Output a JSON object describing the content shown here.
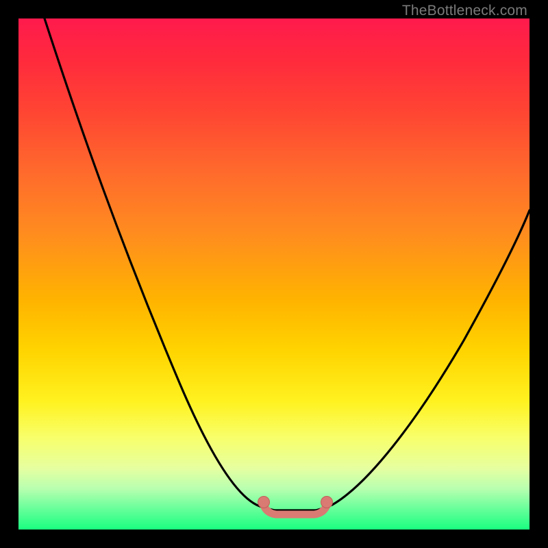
{
  "watermark": "TheBottleneck.com",
  "colors": {
    "frame": "#000000",
    "curve": "#000000",
    "marker_fill": "#d97a73",
    "marker_stroke": "#c06058",
    "gradient_stops": [
      "#ff1a4d",
      "#ff2a3d",
      "#ff4433",
      "#ff6a2c",
      "#ff8c1f",
      "#ffb300",
      "#ffd400",
      "#fff220",
      "#f8ff6a",
      "#e6ffa0",
      "#b8ffb0",
      "#66ff99",
      "#1aff80"
    ]
  },
  "chart_data": {
    "type": "line",
    "title": "",
    "xlabel": "",
    "ylabel": "",
    "xlim": [
      0,
      100
    ],
    "ylim": [
      0,
      100
    ],
    "series": [
      {
        "name": "bottleneck-curve",
        "x": [
          0,
          5,
          10,
          15,
          20,
          25,
          30,
          35,
          40,
          45,
          48,
          50,
          52,
          54,
          56,
          58,
          62,
          68,
          75,
          82,
          90,
          100
        ],
        "y": [
          100,
          90,
          80,
          70,
          60,
          50,
          40,
          30,
          20,
          10,
          4,
          2,
          2,
          2,
          2,
          4,
          10,
          20,
          32,
          44,
          56,
          68
        ]
      }
    ],
    "markers": [
      {
        "x": 48,
        "y": 4
      },
      {
        "x": 58,
        "y": 4
      }
    ],
    "flat_segment": {
      "x_start": 48,
      "x_end": 58,
      "y": 2
    }
  }
}
